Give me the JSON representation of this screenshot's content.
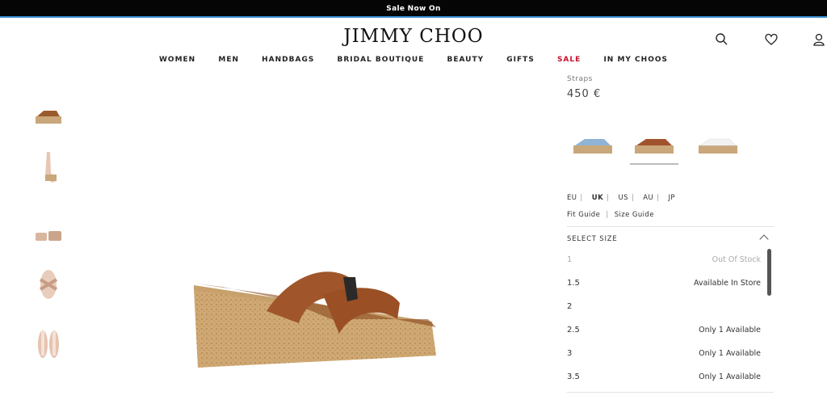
{
  "promo": {
    "text": "Sale Now On"
  },
  "header": {
    "logo": "JIMMY CHOO",
    "nav": [
      "WOMEN",
      "MEN",
      "HANDBAGS",
      "BRIDAL BOUTIQUE",
      "BEAUTY",
      "GIFTS",
      "SALE",
      "IN MY CHOOS"
    ],
    "icons": [
      "search-icon",
      "heart-icon",
      "user-icon"
    ],
    "colors": {
      "sale": "#c8102e",
      "promo_bg": "#050505",
      "promo_border": "#3a8fd0"
    }
  },
  "thumbnails": [
    {
      "name": "thumb-side-view"
    },
    {
      "name": "thumb-on-foot"
    },
    {
      "name": "thumb-pair-view"
    },
    {
      "name": "thumb-top-view"
    },
    {
      "name": "thumb-sole-view"
    }
  ],
  "product": {
    "crumb": "Straps",
    "price": "450 €",
    "variants": [
      {
        "name": "denim",
        "color": "#8fb4d6"
      },
      {
        "name": "tan",
        "color": "#a0522d",
        "active": true
      },
      {
        "name": "white",
        "color": "#f2f2f2"
      }
    ],
    "size_systems": [
      "EU",
      "UK",
      "US",
      "AU",
      "JP"
    ],
    "active_system": "UK",
    "guides": [
      "Fit Guide",
      "Size Guide"
    ],
    "select_size_label": "SELECT SIZE",
    "sizes": [
      {
        "label": "1",
        "status": "Out Of Stock",
        "oos": true
      },
      {
        "label": "1.5",
        "status": "Available In Store"
      },
      {
        "label": "2",
        "status": ""
      },
      {
        "label": "2.5",
        "status": "Only 1 Available"
      },
      {
        "label": "3",
        "status": "Only 1 Available"
      },
      {
        "label": "3.5",
        "status": "Only 1 Available"
      }
    ]
  }
}
